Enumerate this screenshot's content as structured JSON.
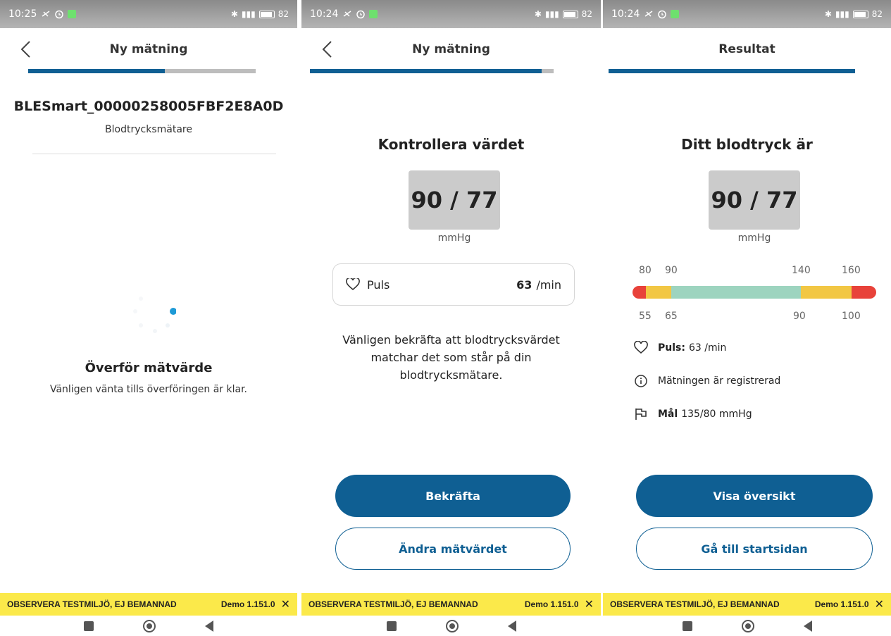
{
  "screens": [
    {
      "status": {
        "time": "10:25",
        "battery": "82"
      },
      "header": {
        "title": "Ny mätning"
      },
      "progress": 0.6,
      "device": {
        "name": "BLESmart_00000258005FBF2E8A0D",
        "type": "Blodtrycksmätare"
      },
      "transfer": {
        "title": "Överför mätvärde",
        "subtitle": "Vänligen vänta tills överföringen är klar."
      },
      "banner": {
        "text": "OBSERVERA TESTMILJÖ, EJ BEMANNAD",
        "version": "Demo 1.151.0"
      }
    },
    {
      "status": {
        "time": "10:24",
        "battery": "82"
      },
      "header": {
        "title": "Ny mätning"
      },
      "progress": 0.95,
      "heading": "Kontrollera värdet",
      "bp": {
        "value": "90 / 77",
        "unit": "mmHg"
      },
      "pulse": {
        "label": "Puls",
        "value": "63",
        "unit": "/min"
      },
      "message": "Vänligen bekräfta att blodtrycksvärdet matchar det som står på din blodtrycksmätare.",
      "buttons": {
        "primary": "Bekräfta",
        "secondary": "Ändra mätvärdet"
      },
      "banner": {
        "text": "OBSERVERA TESTMILJÖ, EJ BEMANNAD",
        "version": "Demo 1.151.0"
      }
    },
    {
      "status": {
        "time": "10:24",
        "battery": "82"
      },
      "header": {
        "title": "Resultat"
      },
      "progress": 1.0,
      "heading": "Ditt blodtryck är",
      "bp": {
        "value": "90 / 77",
        "unit": "mmHg"
      },
      "scale": {
        "top_labels": [
          "80",
          "90",
          "140",
          "160"
        ],
        "bottom_labels": [
          "55",
          "65",
          "90",
          "100"
        ],
        "segments": [
          {
            "color": "#e8423a",
            "fraction": 0.055
          },
          {
            "color": "#f2c744",
            "fraction": 0.105
          },
          {
            "color": "#9dd4bf",
            "fraction": 0.53
          },
          {
            "color": "#f2c744",
            "fraction": 0.21
          },
          {
            "color": "#e8423a",
            "fraction": 0.1
          }
        ]
      },
      "pulse": {
        "label": "Puls:",
        "value": "63 /min"
      },
      "registered": "Mätningen är registrerad",
      "goal": {
        "label": "Mål",
        "value": "135/80 mmHg"
      },
      "buttons": {
        "primary": "Visa översikt",
        "secondary": "Gå till startsidan"
      },
      "banner": {
        "text": "OBSERVERA TESTMILJÖ, EJ BEMANNAD",
        "version": "Demo 1.151.0"
      }
    }
  ],
  "colors": {
    "primary": "#0f5f93",
    "banner": "#fbe94a",
    "spinner": "#1e9ad6"
  },
  "icons": {
    "back": "chevron-left-icon",
    "pulse": "heart-icon",
    "info": "info-icon",
    "goal": "flag-icon",
    "close": "close-icon"
  }
}
